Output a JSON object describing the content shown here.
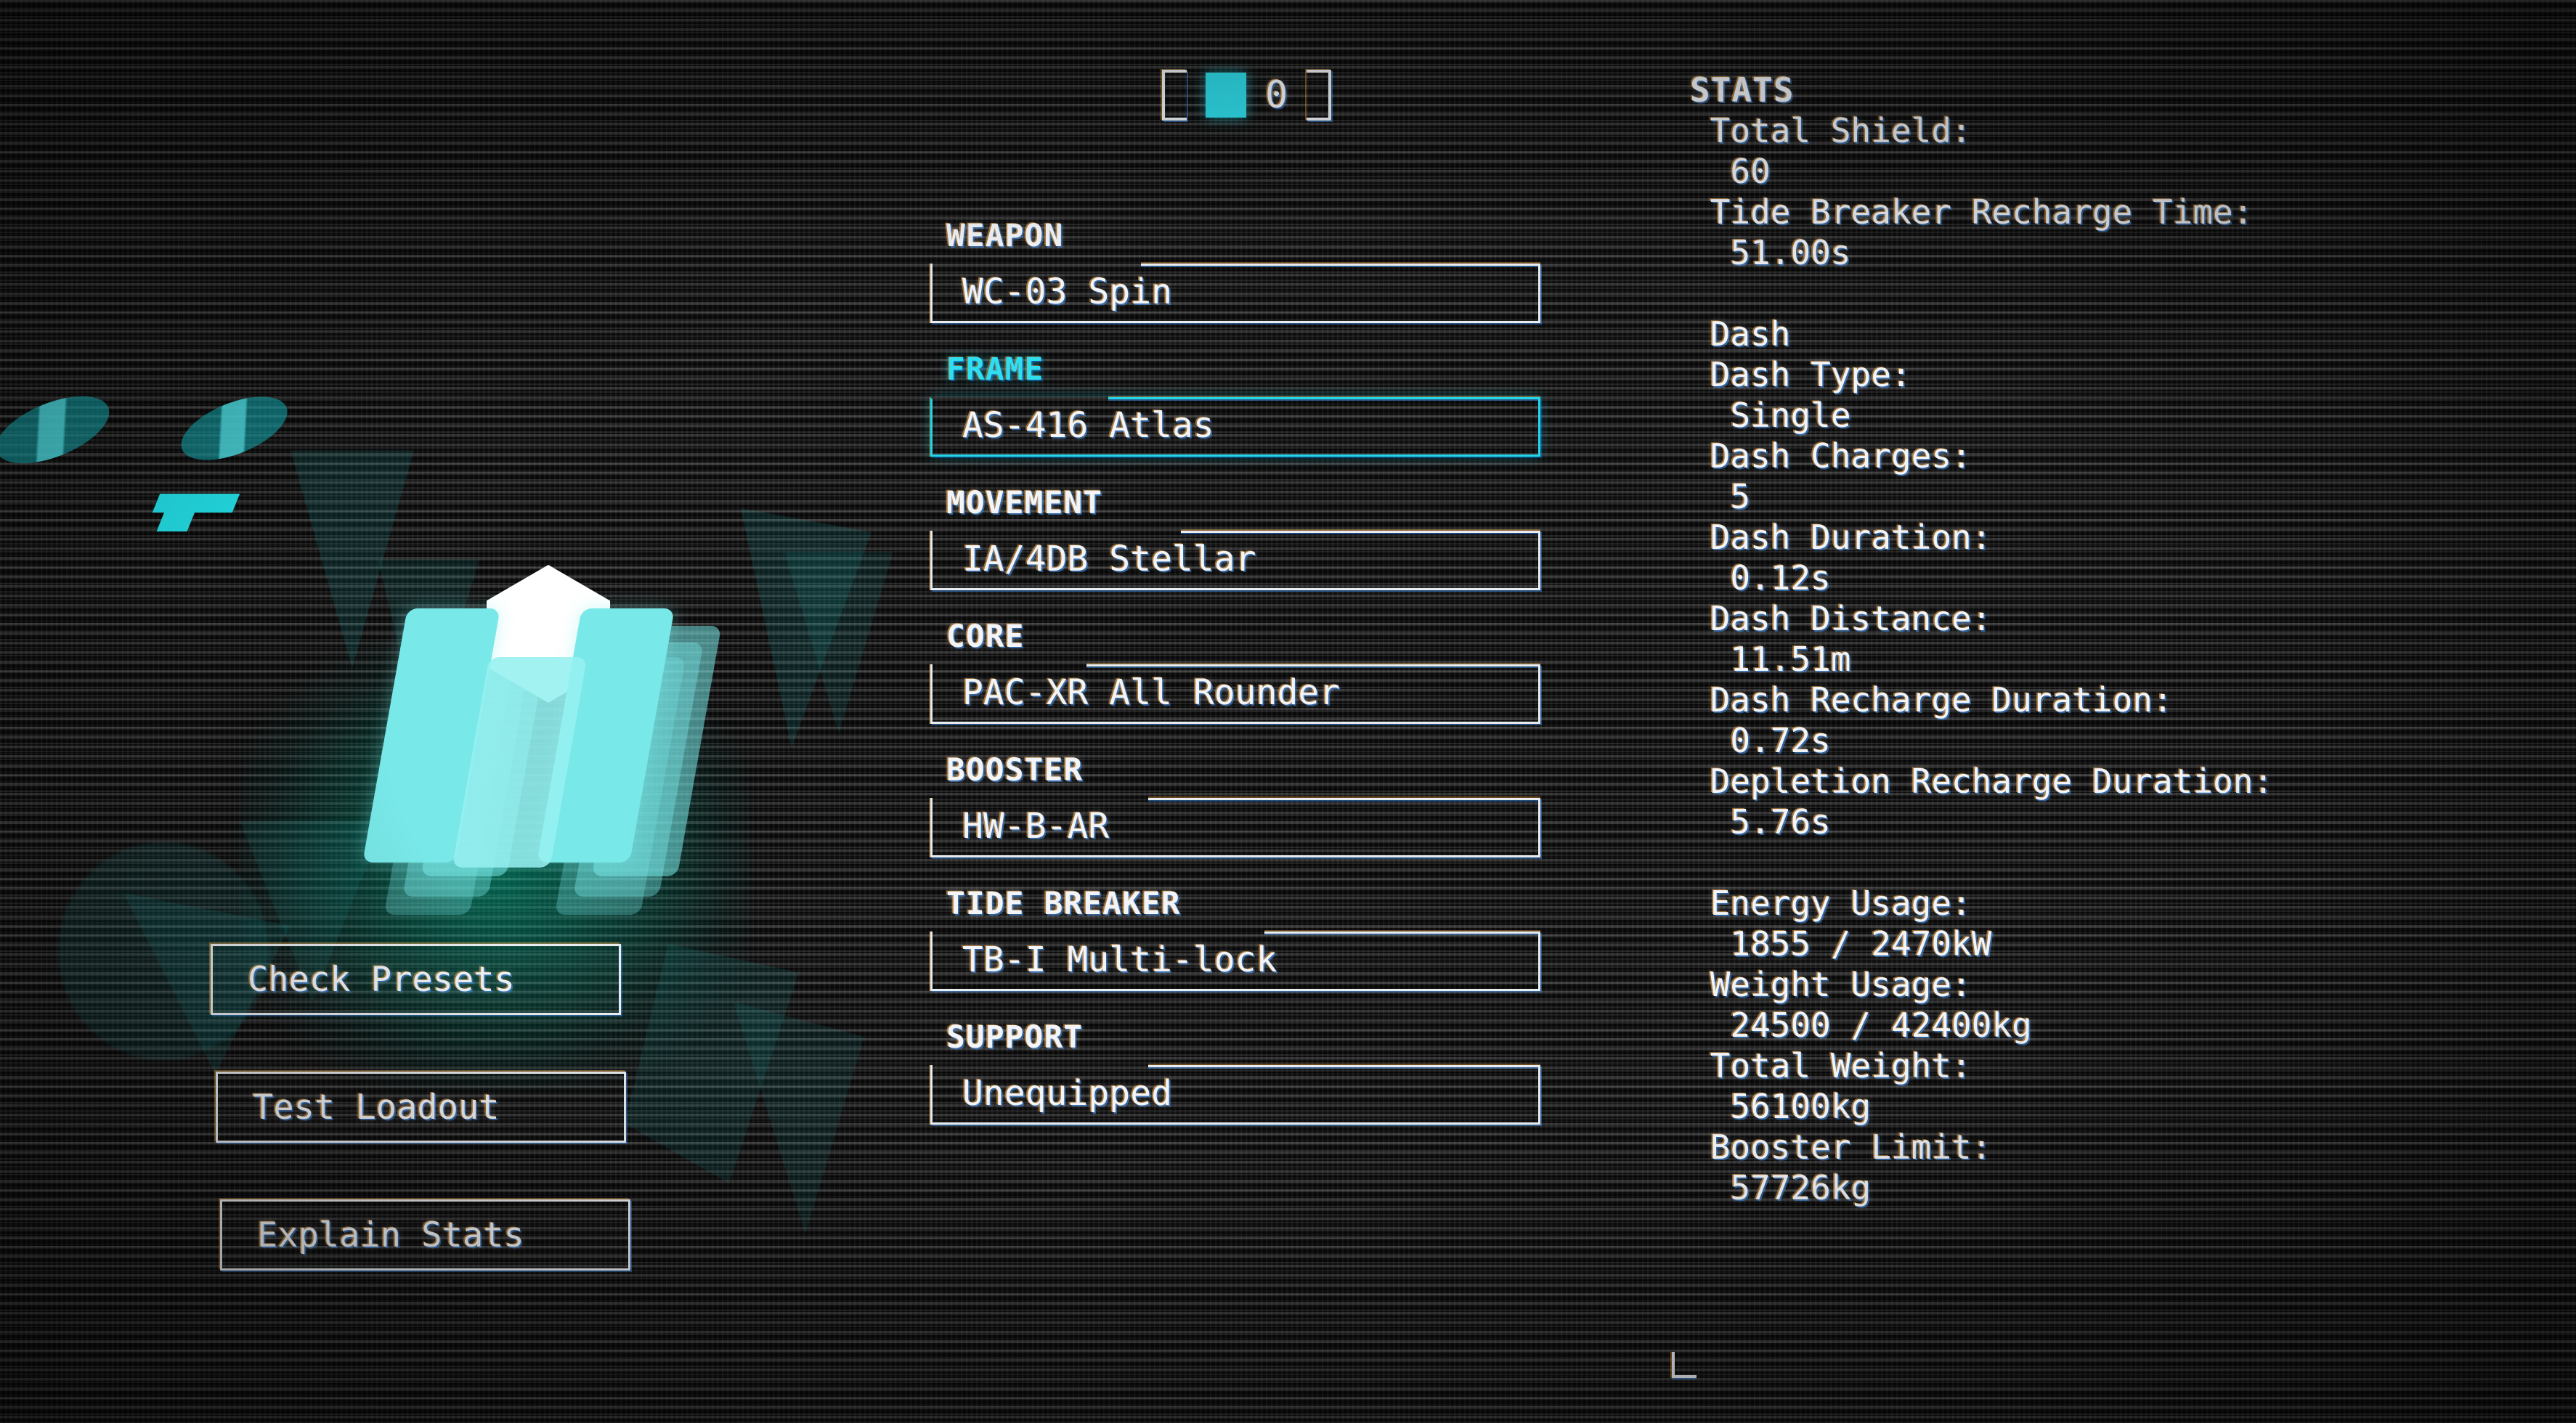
{
  "counter": {
    "icon": "cyan-cube",
    "value": "0",
    "bracket_left": "[",
    "bracket_right": "]"
  },
  "buttons": [
    {
      "label": "Check Presets",
      "name": "check-presets-button"
    },
    {
      "label": "Test Loadout",
      "name": "test-loadout-button"
    },
    {
      "label": "Explain Stats",
      "name": "explain-stats-button"
    }
  ],
  "slots": [
    {
      "label": "WEAPON",
      "value": "WC-03 Spin",
      "selected": false
    },
    {
      "label": "FRAME",
      "value": "AS-416 Atlas",
      "selected": true
    },
    {
      "label": "MOVEMENT",
      "value": "IA/4DB Stellar",
      "selected": false
    },
    {
      "label": "CORE",
      "value": "PAC-XR All Rounder",
      "selected": false
    },
    {
      "label": "BOOSTER",
      "value": "HW-B-AR",
      "selected": false
    },
    {
      "label": "TIDE BREAKER",
      "value": "TB-I Multi-lock",
      "selected": false
    },
    {
      "label": "SUPPORT",
      "value": "Unequipped",
      "selected": false
    }
  ],
  "stats": {
    "title": "STATS",
    "lines": [
      {
        "text": " Total Shield:",
        "kind": "label"
      },
      {
        "text": "  60",
        "kind": "value"
      },
      {
        "text": " Tide Breaker Recharge Time:",
        "kind": "label"
      },
      {
        "text": "  51.00s",
        "kind": "value"
      },
      {
        "text": "",
        "kind": "gap"
      },
      {
        "text": " Dash",
        "kind": "group"
      },
      {
        "text": " Dash Type:",
        "kind": "label"
      },
      {
        "text": "  Single",
        "kind": "value"
      },
      {
        "text": " Dash Charges:",
        "kind": "label"
      },
      {
        "text": "  5",
        "kind": "value"
      },
      {
        "text": " Dash Duration:",
        "kind": "label"
      },
      {
        "text": "  0.12s",
        "kind": "value"
      },
      {
        "text": " Dash Distance:",
        "kind": "label"
      },
      {
        "text": "  11.51m",
        "kind": "value"
      },
      {
        "text": " Dash Recharge Duration:",
        "kind": "label"
      },
      {
        "text": "  0.72s",
        "kind": "value"
      },
      {
        "text": " Depletion Recharge Duration:",
        "kind": "label"
      },
      {
        "text": "  5.76s",
        "kind": "value"
      },
      {
        "text": "",
        "kind": "gap"
      },
      {
        "text": " Energy Usage:",
        "kind": "label"
      },
      {
        "text": "  1855 / 2470kW",
        "kind": "value"
      },
      {
        "text": " Weight Usage:",
        "kind": "label"
      },
      {
        "text": "  24500 / 42400kg",
        "kind": "value"
      },
      {
        "text": " Total Weight:",
        "kind": "label"
      },
      {
        "text": "  56100kg",
        "kind": "value"
      },
      {
        "text": " Booster Limit:",
        "kind": "label"
      },
      {
        "text": "  57726kg",
        "kind": "value"
      }
    ]
  },
  "colors": {
    "accent_cyan": "#2fdbe8",
    "selected_cyan": "#20d8ea",
    "text": "#f2f4f7",
    "mech_body": "#79e8e8",
    "mech_head": "#ffffff",
    "glow_green": "#00be96"
  }
}
